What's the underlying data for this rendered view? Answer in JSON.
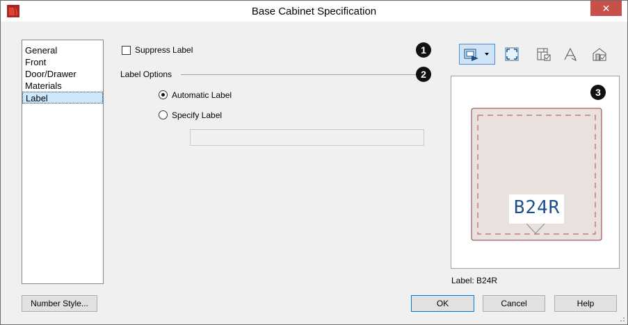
{
  "window": {
    "title": "Base Cabinet Specification",
    "close_label": "✕"
  },
  "nav": {
    "items": [
      {
        "label": "General",
        "selected": false
      },
      {
        "label": "Front",
        "selected": false
      },
      {
        "label": "Door/Drawer",
        "selected": false
      },
      {
        "label": "Materials",
        "selected": false
      },
      {
        "label": "Label",
        "selected": true
      }
    ]
  },
  "label_panel": {
    "suppress_label": "Suppress Label",
    "suppress_checked": false,
    "options_heading": "Label Options",
    "automatic_label": "Automatic Label",
    "specify_label": "Specify Label",
    "selected_option": "automatic",
    "specify_value": ""
  },
  "callouts": [
    "1",
    "2",
    "3"
  ],
  "toolbar": {
    "icons": [
      "camera-view-dropdown-icon",
      "fill-window-icon",
      "plan-view-icon",
      "elevation-view-icon",
      "3d-view-icon"
    ]
  },
  "preview": {
    "cabinet_label": "B24R",
    "caption": "Label: B24R"
  },
  "buttons": {
    "number_style": "Number Style...",
    "ok": "OK",
    "cancel": "Cancel",
    "help": "Help"
  },
  "colors": {
    "cabinet_fill": "#e9e1de",
    "cabinet_border": "#8a3a3a",
    "label_text": "#1e4f8c",
    "close_bg": "#c7504b"
  }
}
